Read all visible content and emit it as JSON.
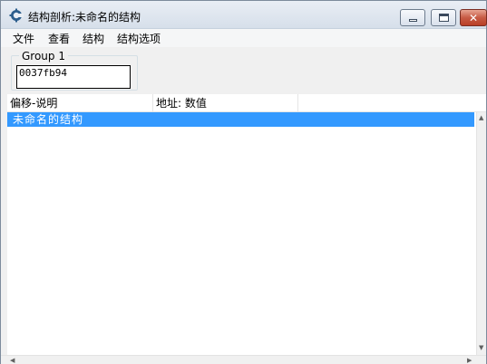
{
  "window": {
    "title": "结构剖析:未命名的结构",
    "icon": "cheat-engine-gear-icon"
  },
  "title_buttons": {
    "minimize": "minimize-icon",
    "maximize": "maximize-icon",
    "close": "close-icon"
  },
  "menu": {
    "items": [
      "文件",
      "查看",
      "结构",
      "结构选项"
    ]
  },
  "group": {
    "label": "Group 1",
    "address": "0037fb94"
  },
  "columns": [
    "偏移-说明",
    "地址: 数值"
  ],
  "tree": {
    "rows": [
      {
        "label": "未命名的结构",
        "selected": true
      }
    ]
  },
  "colors": {
    "selection": "#3399ff",
    "close_button": "#c75b45"
  }
}
